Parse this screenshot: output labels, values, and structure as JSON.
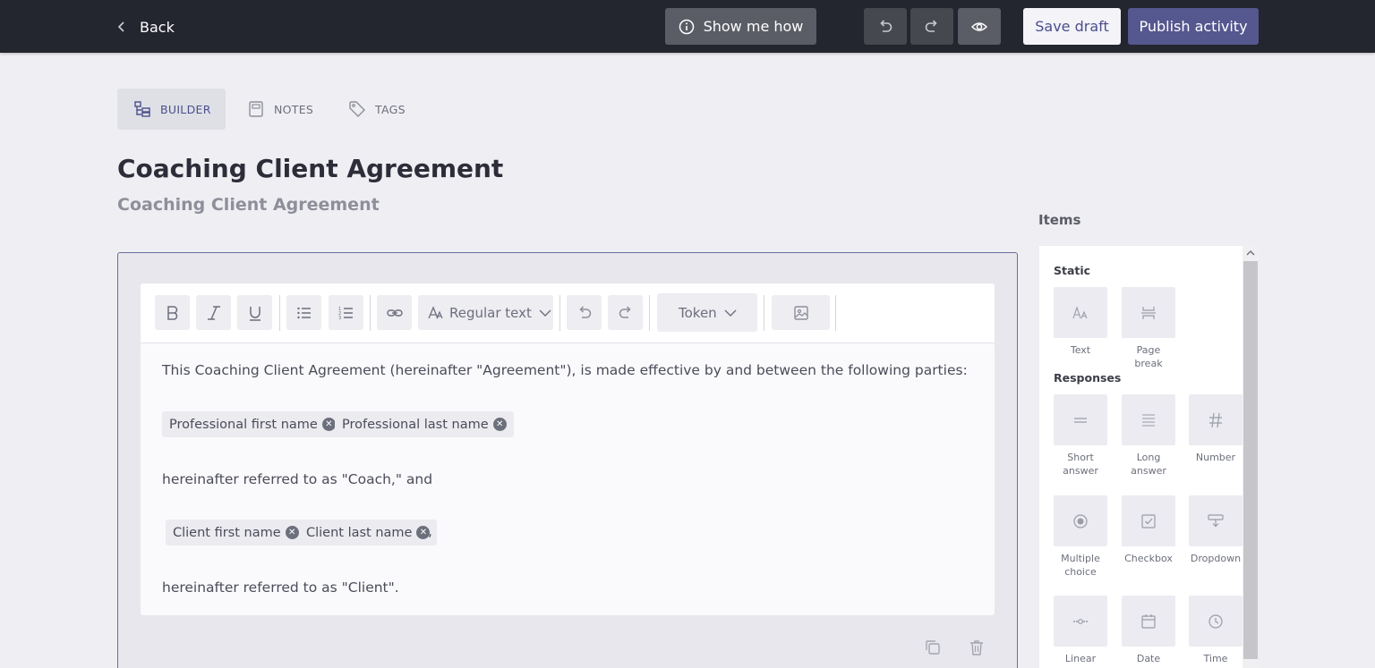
{
  "header": {
    "back_label": "Back",
    "show_me_how_label": "Show me how",
    "save_draft_label": "Save draft",
    "publish_label": "Publish activity"
  },
  "tabs": [
    {
      "label": "BUILDER",
      "icon": "builder-icon",
      "active": true
    },
    {
      "label": "NOTES",
      "icon": "notes-icon",
      "active": false
    },
    {
      "label": "TAGS",
      "icon": "tag-icon",
      "active": false
    }
  ],
  "page": {
    "title": "Coaching Client Agreement",
    "subtitle": "Coaching Client Agreement"
  },
  "editor": {
    "toolbar": {
      "text_style": "Regular text",
      "token_label": "Token"
    },
    "paragraphs": {
      "intro": "This Coaching Client Agreement (hereinafter \"Agreement\"), is made effective by and between the following parties:",
      "coach": "hereinafter referred to as \"Coach,\" and",
      "comma": ",",
      "client": "hereinafter referred to as \"Client\"."
    },
    "tokens_professional": [
      "Professional first name",
      "Professional last name"
    ],
    "tokens_client": [
      "Client first name",
      "Client last name"
    ]
  },
  "items_panel": {
    "heading": "Items",
    "static_label": "Static",
    "responses_label": "Responses",
    "static_items": [
      {
        "label": "Text",
        "icon": "text-icon"
      },
      {
        "label": "Page break",
        "icon": "page-break-icon"
      }
    ],
    "response_items": [
      {
        "label": "Short answer",
        "icon": "short-answer-icon"
      },
      {
        "label": "Long answer",
        "icon": "long-answer-icon"
      },
      {
        "label": "Number",
        "icon": "number-icon"
      },
      {
        "label": "Multiple choice",
        "icon": "multiple-choice-icon"
      },
      {
        "label": "Checkbox",
        "icon": "checkbox-icon"
      },
      {
        "label": "Dropdown",
        "icon": "dropdown-icon"
      },
      {
        "label": "Linear scale",
        "icon": "linear-scale-icon"
      },
      {
        "label": "Date",
        "icon": "date-icon"
      },
      {
        "label": "Time",
        "icon": "time-icon"
      }
    ]
  },
  "colors": {
    "topbar": "#23252f",
    "accent": "#55578f",
    "page_bg": "#efeff3"
  }
}
